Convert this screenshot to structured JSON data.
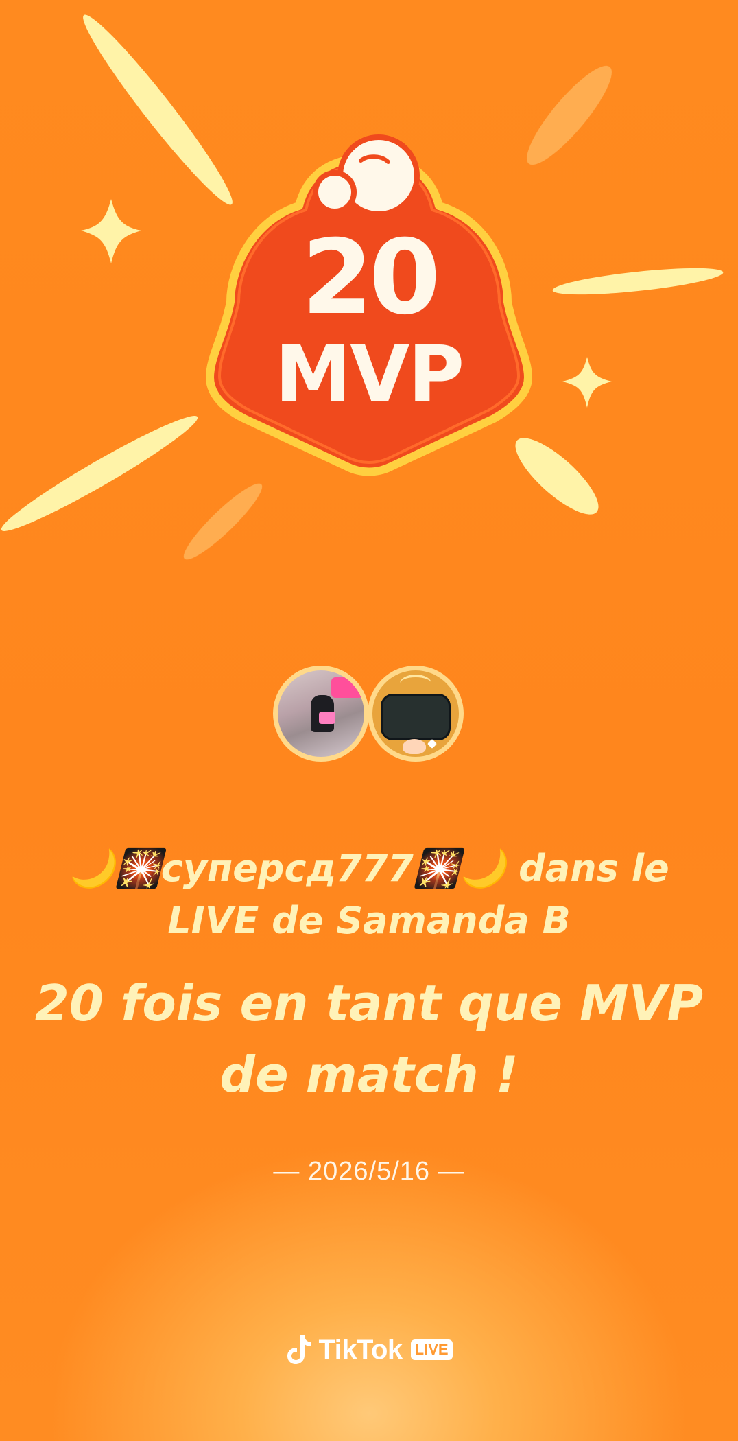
{
  "badge": {
    "count": "20",
    "label": "MVP"
  },
  "participants": {
    "avatars": [
      {
        "name": "user-avatar"
      },
      {
        "name": "host-avatar"
      }
    ]
  },
  "message": {
    "user_line": "🌙🎇суперсд777🎇🌙 dans le LIVE de Samanda B",
    "headline": "20 fois en tant que MVP de match !",
    "date": "— 2026/5/16 —"
  },
  "brand": {
    "name": "TikTok",
    "tag": "LIVE"
  },
  "colors": {
    "background": "#ff8a1f",
    "text_highlight": "#fff2b8",
    "badge_red": "#f04a1d",
    "badge_border": "#ffd040",
    "ray_yellow": "#fff3a8"
  }
}
